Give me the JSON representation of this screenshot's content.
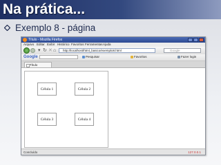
{
  "slide": {
    "title": "Na prática...",
    "bullet": "Exemplo 8 - página"
  },
  "window": {
    "title": "Título - Mozilla Firefox"
  },
  "menu": {
    "items": [
      "Arquivo",
      "Editar",
      "Exibir",
      "Histórico",
      "Favoritos",
      "Ferramentas",
      "Ajuda"
    ]
  },
  "navbar": {
    "url": "http://localhost/html_basico/exemplo8.html",
    "search_placeholder": "Google"
  },
  "googlebar": {
    "logo": "Google",
    "buttons": [
      "Pesquisar",
      "Favoritos",
      "Fazer login"
    ]
  },
  "tab": {
    "label": "Título"
  },
  "page": {
    "cells": [
      "Célula 1",
      "Célula 2",
      "Célula 3",
      "Célula 4"
    ]
  },
  "status": {
    "text": "Concluído",
    "right": "127.0.0.1"
  },
  "colors": {
    "title_bar": "#1f2f63",
    "accent": "#3b63c5"
  }
}
